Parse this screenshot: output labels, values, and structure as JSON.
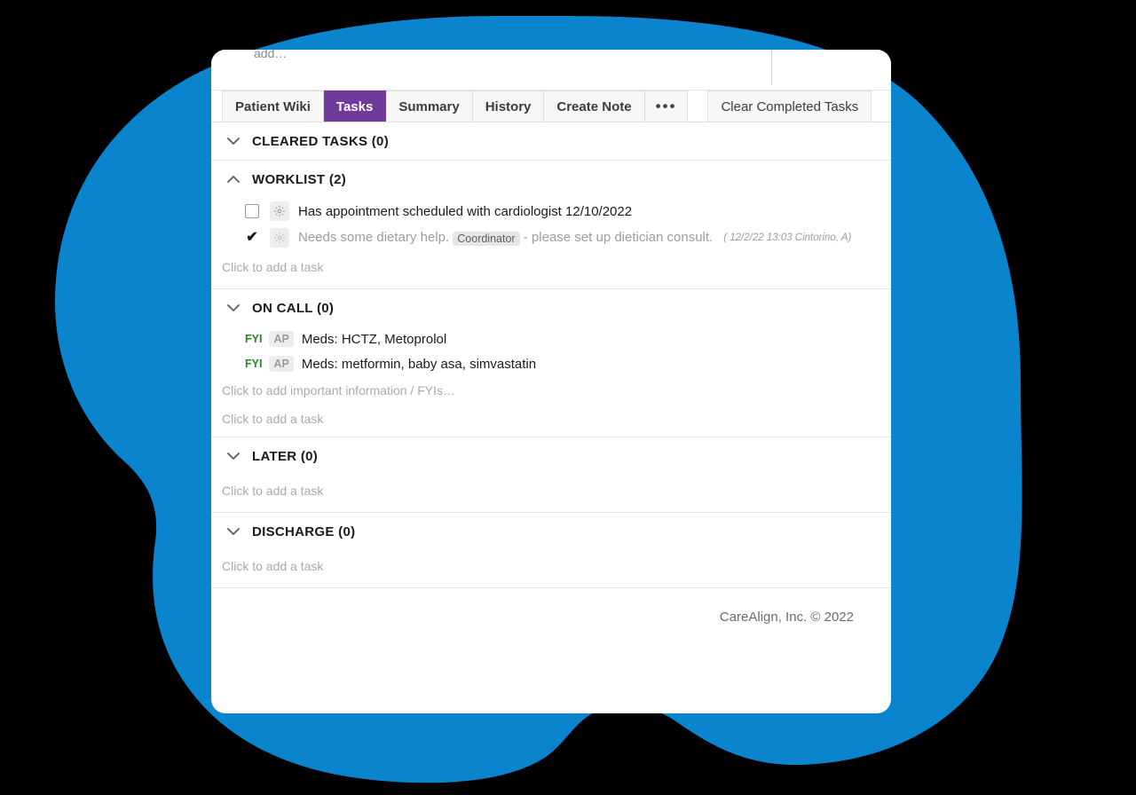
{
  "theme": {
    "blob_color": "#0a85cd",
    "backdrop_color": "#000000",
    "active_tab_color": "#703a9b",
    "fyi_color": "#1f8a1f",
    "card_color": "#ffffff"
  },
  "top_bar": {
    "cutoff_text": "add…"
  },
  "tabs": [
    {
      "label": "Patient Wiki",
      "active": false
    },
    {
      "label": "Tasks",
      "active": true
    },
    {
      "label": "Summary",
      "active": false
    },
    {
      "label": "History",
      "active": false
    },
    {
      "label": "Create Note",
      "active": false
    },
    {
      "label": "•••",
      "active": false
    }
  ],
  "toolbar": {
    "clear_completed_label": "Clear Completed Tasks"
  },
  "sections": [
    {
      "title": "CLEARED TASKS (0)",
      "expanded": false,
      "chevron": "chevron-down-icon"
    },
    {
      "title": "WORKLIST (2)",
      "expanded": true,
      "chevron": "chevron-up-icon",
      "tasks": [
        {
          "checked": false,
          "text": "Has appointment scheduled with cardiologist 12/10/2022",
          "done": false
        },
        {
          "checked": true,
          "done": true,
          "text_before": "Needs some dietary help.",
          "chip": "Coordinator",
          "text_after": "- please set up dietician consult.",
          "stamp": "( 12/2/22 13:03 Cintorino, A)"
        }
      ],
      "add_task_hint": "Click to add a task"
    },
    {
      "title": "ON CALL (0)",
      "expanded": false,
      "chevron": "chevron-down-icon",
      "fyis": [
        {
          "tag": "FYI",
          "badge": "AP",
          "text": "Meds: HCTZ, Metoprolol"
        },
        {
          "tag": "FYI",
          "badge": "AP",
          "text": "Meds: metformin, baby asa, simvastatin"
        }
      ],
      "add_fyi_hint": "Click to add important information / FYIs…",
      "add_task_hint": "Click to add a task"
    },
    {
      "title": "LATER (0)",
      "expanded": false,
      "chevron": "chevron-down-icon",
      "add_task_hint": "Click to add a task"
    },
    {
      "title": "DISCHARGE (0)",
      "expanded": false,
      "chevron": "chevron-down-icon",
      "add_task_hint": "Click to add a task"
    }
  ],
  "footer": {
    "copyright": "CareAlign, Inc. © 2022"
  }
}
